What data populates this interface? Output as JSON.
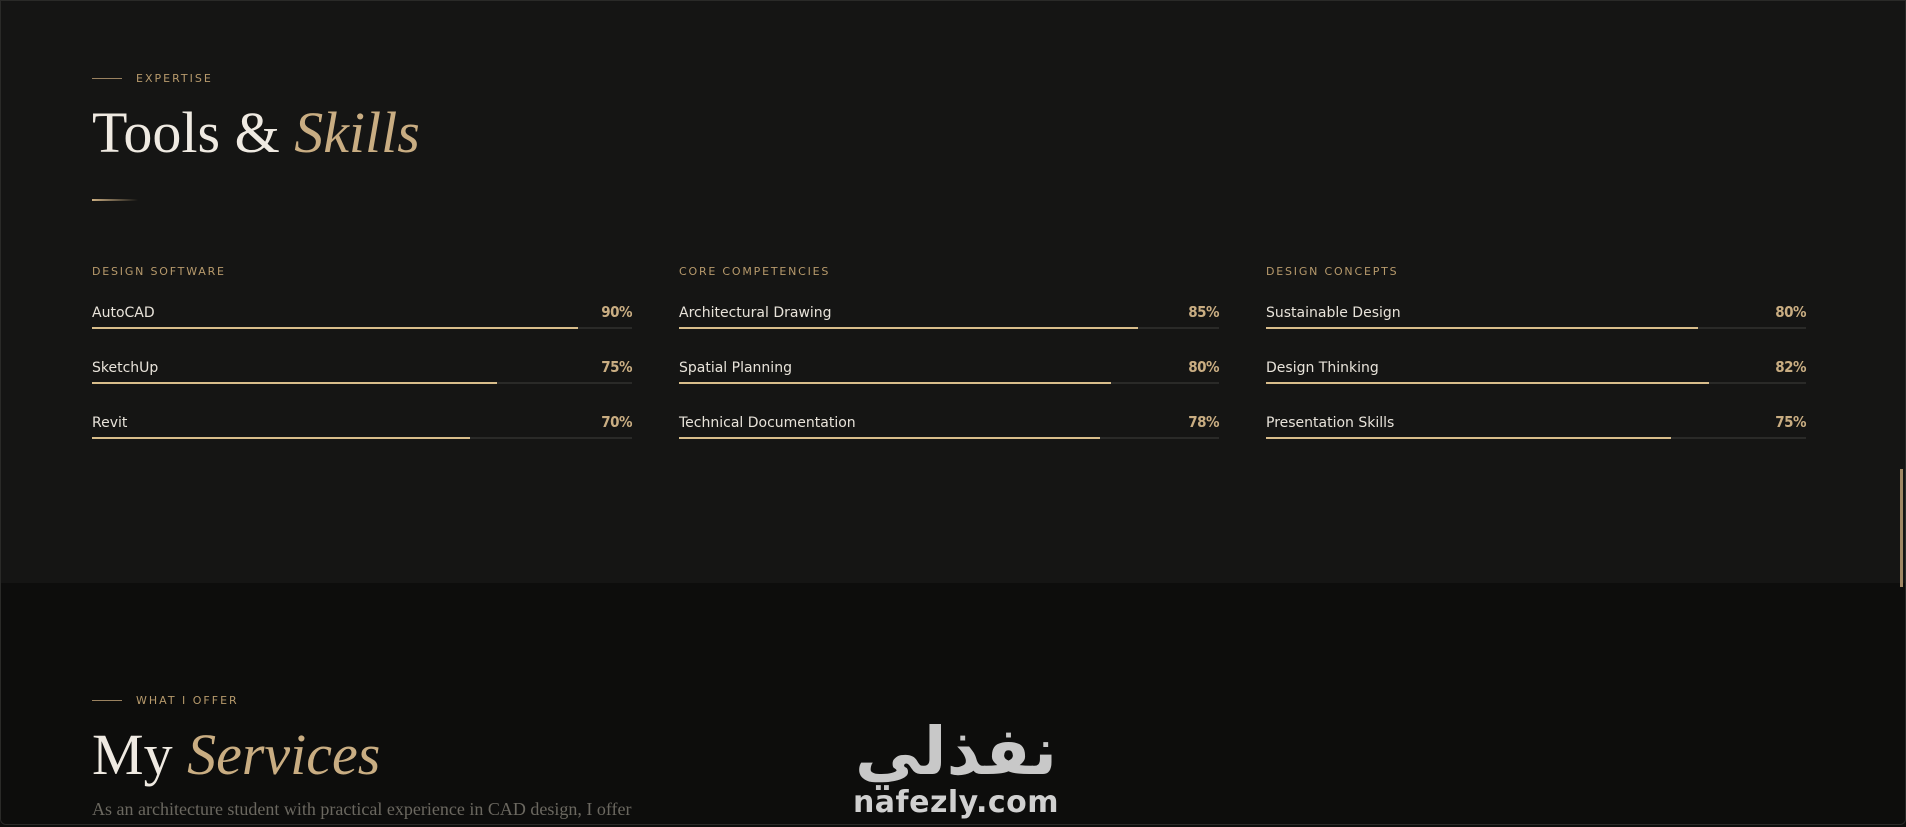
{
  "skills": {
    "eyebrow": "EXPERTISE",
    "heading_main": "Tools & ",
    "heading_accent": "Skills",
    "columns": [
      {
        "title": "DESIGN SOFTWARE",
        "items": [
          {
            "name": "AutoCAD",
            "pct_label": "90%",
            "value": 90
          },
          {
            "name": "SketchUp",
            "pct_label": "75%",
            "value": 75
          },
          {
            "name": "Revit",
            "pct_label": "70%",
            "value": 70
          }
        ]
      },
      {
        "title": "CORE COMPETENCIES",
        "items": [
          {
            "name": "Architectural Drawing",
            "pct_label": "85%",
            "value": 85
          },
          {
            "name": "Spatial Planning",
            "pct_label": "80%",
            "value": 80
          },
          {
            "name": "Technical Documentation",
            "pct_label": "78%",
            "value": 78
          }
        ]
      },
      {
        "title": "DESIGN CONCEPTS",
        "items": [
          {
            "name": "Sustainable Design",
            "pct_label": "80%",
            "value": 80
          },
          {
            "name": "Design Thinking",
            "pct_label": "82%",
            "value": 82
          },
          {
            "name": "Presentation Skills",
            "pct_label": "75%",
            "value": 75
          }
        ]
      }
    ]
  },
  "services": {
    "eyebrow": "WHAT I OFFER",
    "heading_main": "My ",
    "heading_accent": "Services",
    "description": "As an architecture student with practical experience in CAD design, I offer"
  },
  "watermark": {
    "arabic": "نفذلي",
    "latin": "nafezly.com"
  },
  "colors": {
    "accent": "#c9ad82",
    "bar_fill": "#d8bd8b",
    "background": "#151514"
  }
}
